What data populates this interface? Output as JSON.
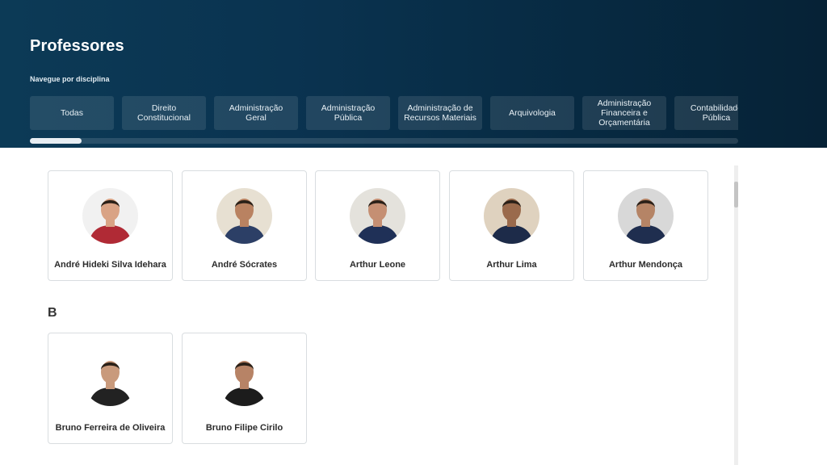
{
  "header": {
    "title": "Professores",
    "nav_caption": "Navegue por disciplina"
  },
  "disciplines": [
    "Todas",
    "Direito\nConstitucional",
    "Administração\nGeral",
    "Administração\nPública",
    "Administração de\nRecursos Materiais",
    "Arquivologia",
    "Administração\nFinanceira e\nOrçamentária",
    "Contabilidade\nPública"
  ],
  "sections": [
    {
      "letter": "",
      "teachers": [
        {
          "name": "André Hideki Silva Idehara",
          "shirt_color": "#b02a35",
          "skin": "#d9a385",
          "bg": "#f1f1f1"
        },
        {
          "name": "André Sócrates",
          "shirt_color": "#2c3f66",
          "skin": "#b98261",
          "bg": "#e7e0d2"
        },
        {
          "name": "Arthur Leone",
          "shirt_color": "#1f3057",
          "skin": "#c58f73",
          "bg": "#e4e2dc"
        },
        {
          "name": "Arthur Lima",
          "shirt_color": "#1d2b49",
          "skin": "#9a6a4c",
          "bg": "#dfd2bf"
        },
        {
          "name": "Arthur Mendonça",
          "shirt_color": "#1f2e4f",
          "skin": "#b58466",
          "bg": "#d8d8d8"
        }
      ]
    },
    {
      "letter": "B",
      "teachers": [
        {
          "name": "Bruno Ferreira de Oliveira",
          "shirt_color": "#222222",
          "skin": "#c99a7c",
          "bg": "#ffffff"
        },
        {
          "name": "Bruno Filipe Cirilo",
          "shirt_color": "#1c1c1c",
          "skin": "#b78366",
          "bg": "#ffffff"
        }
      ]
    }
  ],
  "icons": {
    "avatar": "person-photo-icon"
  }
}
